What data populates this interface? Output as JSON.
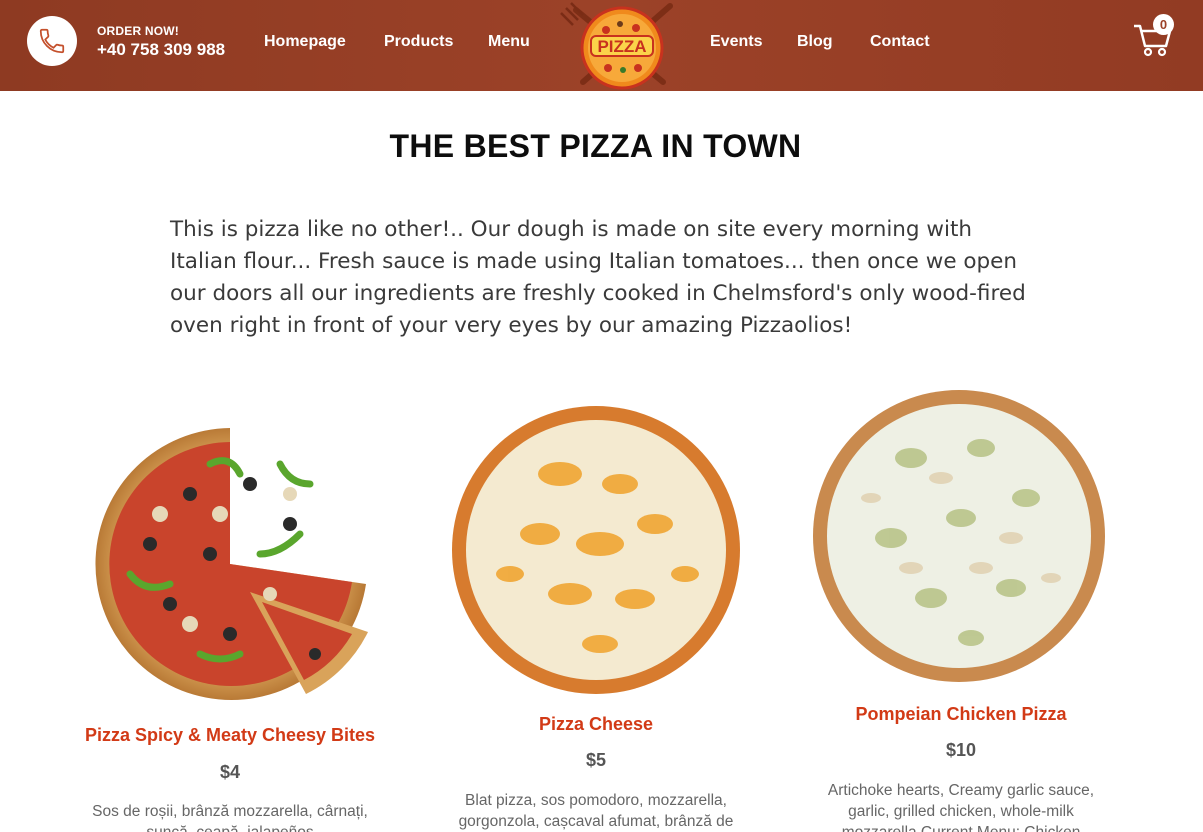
{
  "header": {
    "order_label": "ORDER NOW!",
    "phone": "+40 758 309 988",
    "nav": {
      "homepage": "Homepage",
      "products": "Products",
      "menu": "Menu",
      "events": "Events",
      "blog": "Blog",
      "contact": "Contact"
    },
    "logo_text": "PIZZA",
    "cart_count": "0",
    "colors": {
      "bar": "#9c4228",
      "logo_orange": "#f08a1c",
      "logo_red": "#c8321e"
    }
  },
  "main": {
    "title": "THE BEST PIZZA IN TOWN",
    "intro": "This is pizza like no other!.. Our dough is made on site every morning with Italian flour... Fresh sauce is made using Italian tomatoes... then once we open our doors all our ingredients are freshly cooked in Chelmsford's only wood-fired oven right in front of your very eyes by our amazing Pizzaolios!"
  },
  "products": [
    {
      "name": "Pizza Spicy & Meaty Cheesy Bites",
      "price": "$4",
      "description": "Sos de roșii, brânză mozzarella, cârnați, șuncă, ceapă, jalapeños",
      "image": "pizza-pepperoni-veggie-image"
    },
    {
      "name": "Pizza Cheese",
      "price": "$5",
      "description": "Blat pizza, sos pomodoro, mozzarella, gorgonzola, cașcaval afumat, brânză de",
      "image": "pizza-cheese-image"
    },
    {
      "name": "Pompeian Chicken Pizza",
      "price": "$10",
      "description": "Artichoke hearts, Creamy garlic sauce, garlic, grilled chicken, whole-milk mozzarella Current Menu: Chicken",
      "image": "pizza-chicken-image"
    }
  ],
  "accent_color": "#d23a16"
}
